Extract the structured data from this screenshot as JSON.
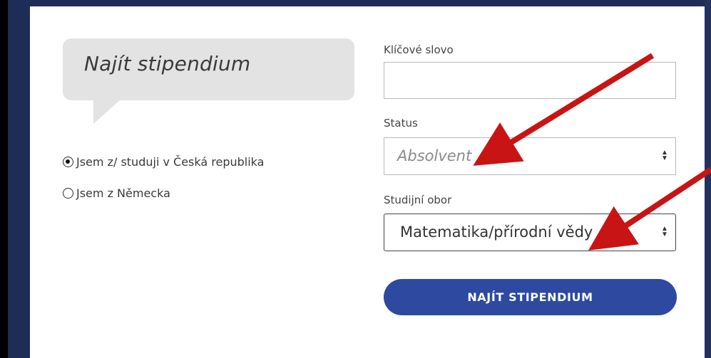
{
  "bubble": {
    "title": "Najít stipendium"
  },
  "radios": [
    {
      "label": "Jsem z/ studuji v Česká republika",
      "checked": true
    },
    {
      "label": "Jsem z Německa",
      "checked": false
    }
  ],
  "form": {
    "keyword_label": "Klíčové slovo",
    "keyword_value": "",
    "status_label": "Status",
    "status_value": "Absolvent",
    "obor_label": "Studijní obor",
    "obor_value": "Matematika/přírodní vědy",
    "submit_label": "NAJÍT STIPENDIUM"
  },
  "icons": {
    "sort": "sort-icon",
    "annotation_arrow": "red-arrow-icon"
  },
  "colors": {
    "page_background": "#1e2d57",
    "panel_background": "#ffffff",
    "bubble": "#e3e3e3",
    "button": "#2d4aa0",
    "annotation": "#c81414"
  }
}
